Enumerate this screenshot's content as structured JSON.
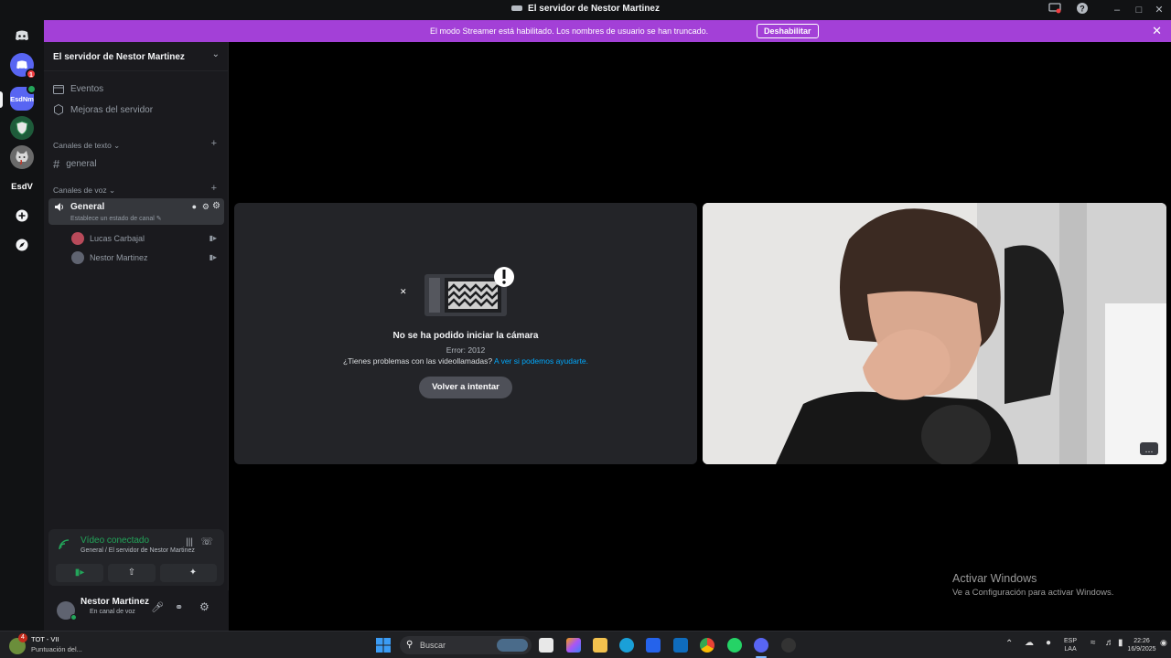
{
  "window": {
    "title": "El servidor de Nestor Martinez",
    "controls": [
      "screen-share-icon",
      "help-icon",
      "minimize-icon",
      "maximize-icon",
      "close-icon"
    ]
  },
  "banner": {
    "message": "El modo Streamer está habilitado. Los nombres de usuario se han truncado.",
    "button_label": "Deshabilitar",
    "color": "#a340d7"
  },
  "guilds": {
    "items": [
      {
        "name": "discord-home-icon",
        "label": ""
      },
      {
        "name": "guild-avatar-1",
        "badge": "1"
      },
      {
        "name": "guild-esdnm",
        "label": "EsdNm"
      },
      {
        "name": "guild-shield",
        "label": ""
      },
      {
        "name": "guild-cat",
        "label": ""
      },
      {
        "name": "guild-esdv",
        "label": "EsdV"
      },
      {
        "name": "add-server-icon",
        "label": "+"
      },
      {
        "name": "discover-icon",
        "label": ""
      }
    ]
  },
  "sidebar": {
    "server_name": "El servidor de Nestor Martinez",
    "items": [
      {
        "label": "Eventos",
        "icon": "calendar-icon"
      },
      {
        "label": "Mejoras del servidor",
        "icon": "boost-icon"
      }
    ],
    "text_category": "Canales de texto",
    "text_channels": [
      {
        "label": "general",
        "icon": "hash-icon"
      }
    ],
    "voice_category": "Canales de voz",
    "voice_channel": {
      "label": "General",
      "status_hint": "Establece un estado de canal",
      "members": [
        {
          "name": "Lucas Carbajal",
          "avatar_color": "#b84a5a"
        },
        {
          "name": "Nestor Martinez",
          "avatar_color": "#5865f2"
        }
      ]
    }
  },
  "voice_panel": {
    "status": "Vídeo conectado",
    "location": "General / El servidor de Nestor Martinez",
    "status_color": "#23a55a",
    "buttons": [
      "camera-icon",
      "screen-share-icon",
      "activity-icon",
      "soundboard-icon"
    ]
  },
  "user_panel": {
    "name": "Nestor Martinez",
    "status": "En canal de voz"
  },
  "camera_error": {
    "title": "No se ha podido iniciar la cámara",
    "code": "Error: 2012",
    "help_text": "¿Tienes problemas con las videollamadas?",
    "help_link": "A ver si podemos ayudarte.",
    "retry_label": "Volver a intentar"
  },
  "watermark": {
    "line1": "Activar Windows",
    "line2": "Ve a Configuración para activar Windows."
  },
  "taskbar": {
    "notification": {
      "title": "TOT - VII",
      "subtitle": "Puntuación del...",
      "badge": "4"
    },
    "search_placeholder": "Buscar",
    "lang_top": "ESP",
    "lang_bottom": "LAA",
    "time": "22:26",
    "date": "16/9/2025"
  }
}
